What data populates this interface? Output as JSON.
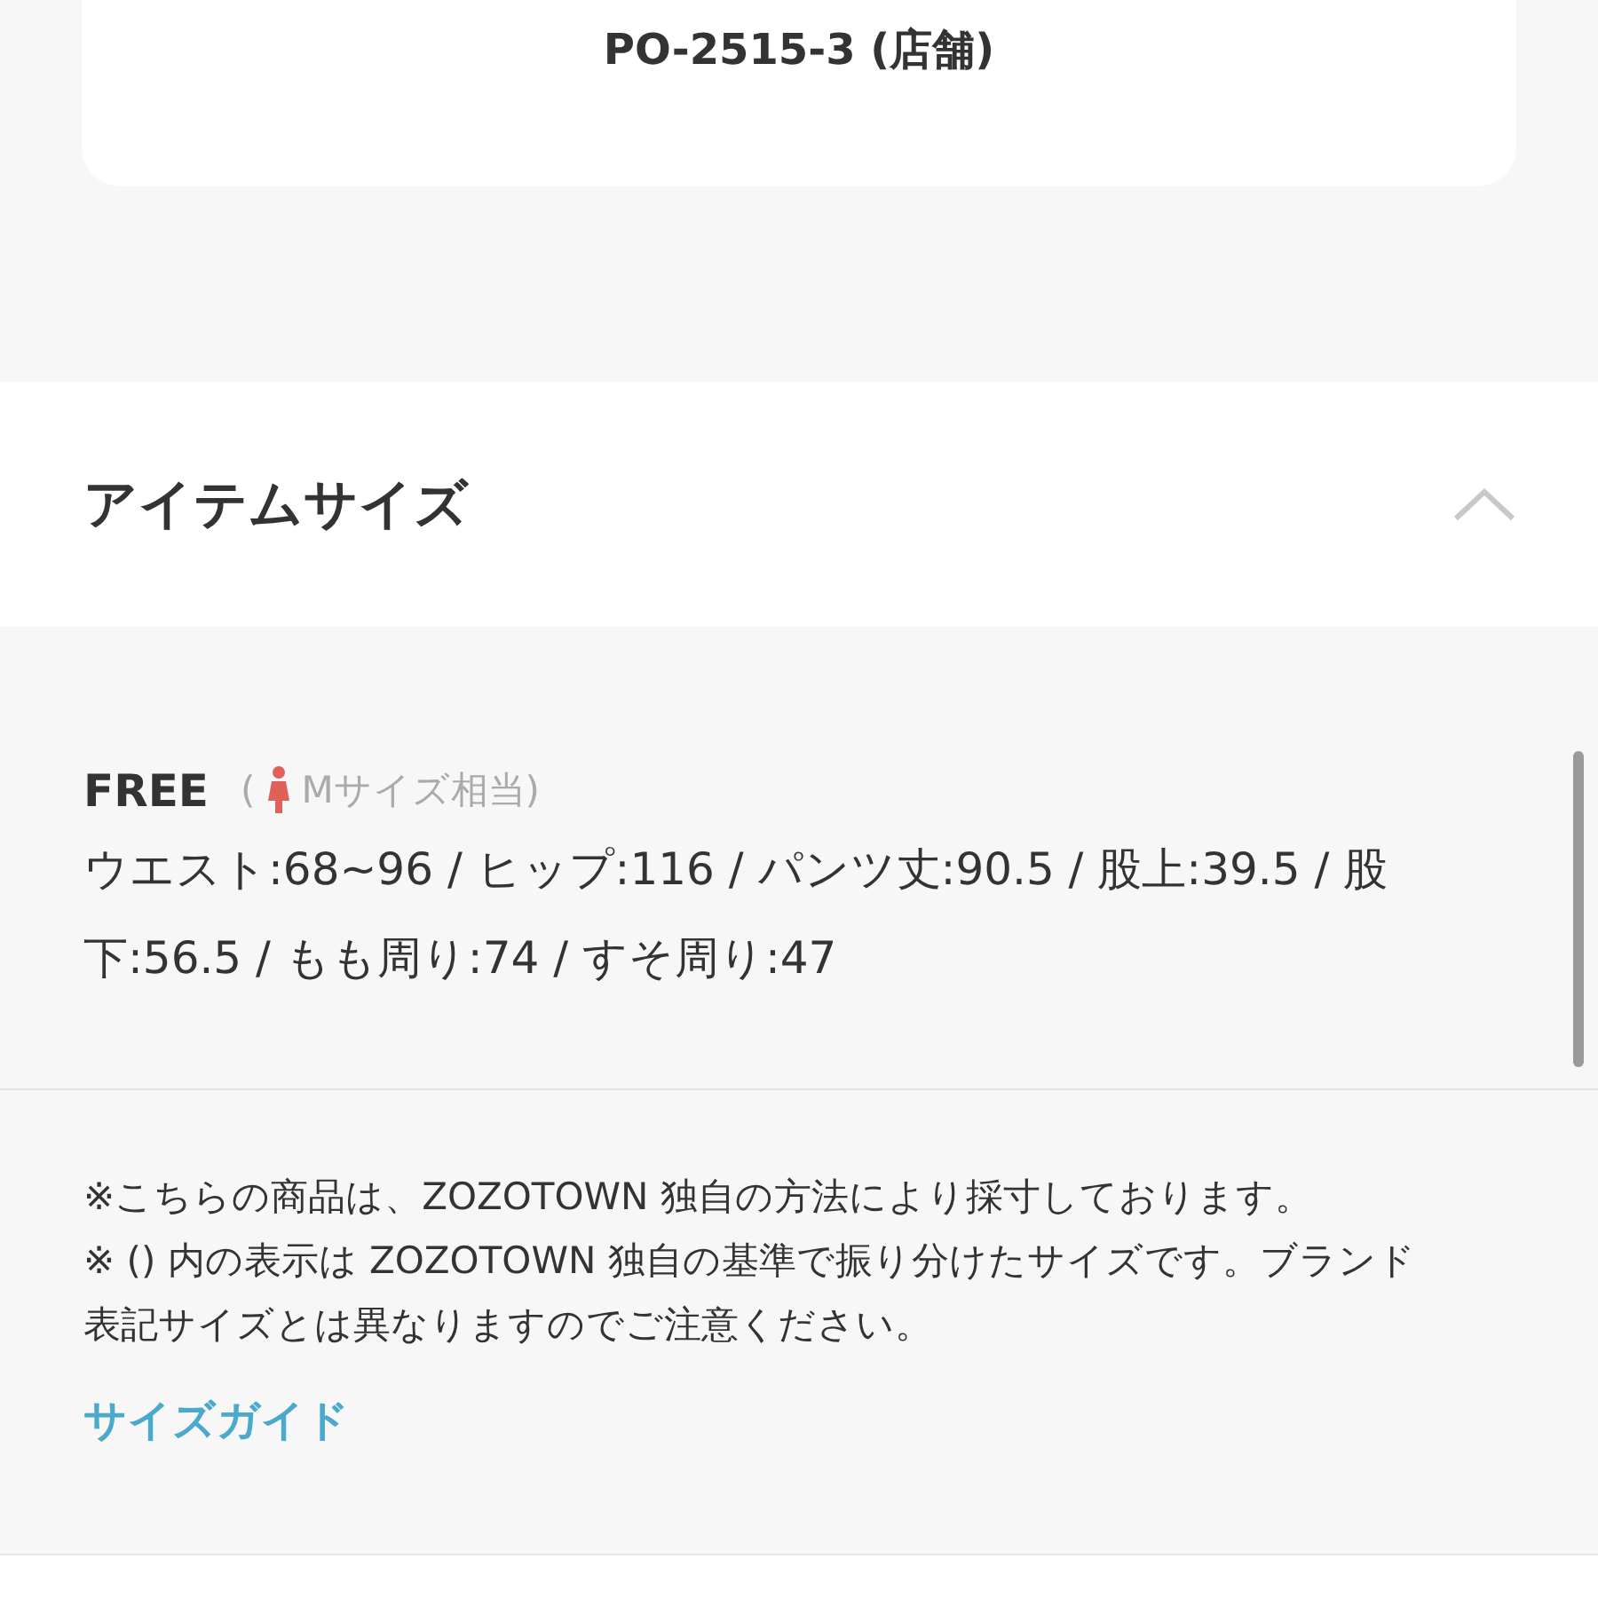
{
  "store_card": {
    "code": "PO-2515-3 (店舗)"
  },
  "item_size": {
    "title": "アイテムサイズ",
    "expanded": true,
    "size": {
      "name": "FREE",
      "open_paren": "(",
      "equivalent": "Mサイズ相当)"
    },
    "measurements": "ウエスト:68~96 / ヒップ:116 / パンツ丈:90.5 / 股上:39.5 / 股下:56.5 / もも周り:74 / すそ周り:47",
    "notes": [
      "※こちらの商品は、ZOZOTOWN 独自の方法により採寸しております。",
      "※ () 内の表示は ZOZOTOWN 独自の基準で振り分けたサイズです。ブランド表記サイズとは異なりますのでご注意ください。"
    ],
    "guide_link": "サイズガイド"
  }
}
